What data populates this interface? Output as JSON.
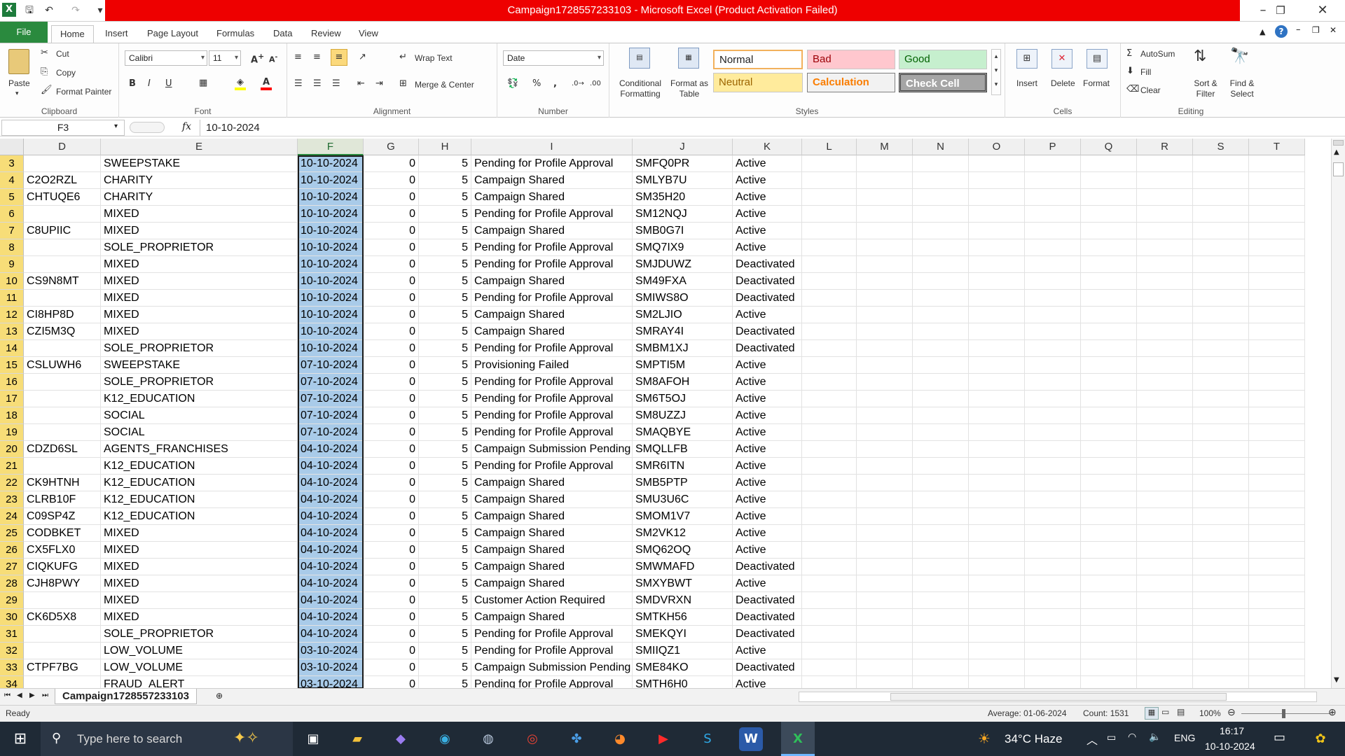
{
  "window": {
    "title": "Campaign1728557233103  -  Microsoft Excel (Product Activation Failed)"
  },
  "ribbon": {
    "tabs": [
      "File",
      "Home",
      "Insert",
      "Page Layout",
      "Formulas",
      "Data",
      "Review",
      "View"
    ],
    "clipboard": {
      "label": "Clipboard",
      "paste": "Paste",
      "cut": "Cut",
      "copy": "Copy",
      "format_painter": "Format Painter"
    },
    "font": {
      "label": "Font",
      "name": "Calibri",
      "size": "11"
    },
    "alignment": {
      "label": "Alignment",
      "wrap_text": "Wrap Text",
      "merge_center": "Merge & Center"
    },
    "number": {
      "label": "Number",
      "format": "Date"
    },
    "styles": {
      "label": "Styles",
      "conditional": "Conditional Formatting",
      "format_as_table": "Format as Table",
      "normal": "Normal",
      "bad": "Bad",
      "good": "Good",
      "neutral": "Neutral",
      "calculation": "Calculation",
      "check_cell": "Check Cell"
    },
    "cells": {
      "label": "Cells",
      "insert": "Insert",
      "delete": "Delete",
      "format": "Format"
    },
    "editing": {
      "label": "Editing",
      "autosum": "AutoSum",
      "fill": "Fill",
      "clear": "Clear",
      "sort_filter": "Sort & Filter",
      "find_select": "Find & Select"
    }
  },
  "formula_bar": {
    "name_box": "F3",
    "fx": "fx",
    "value": "10-10-2024"
  },
  "columns": [
    "D",
    "E",
    "F",
    "G",
    "H",
    "I",
    "J",
    "K",
    "L",
    "M",
    "N",
    "O",
    "P",
    "Q",
    "R",
    "S",
    "T"
  ],
  "rows": [
    {
      "n": "3",
      "d": "",
      "e": "SWEEPSTAKE",
      "f": "10-10-2024",
      "g": "0",
      "h": "5",
      "i": "Pending for Profile Approval",
      "j": "SMFQ0PR",
      "k": "Active"
    },
    {
      "n": "4",
      "d": "C2O2RZL",
      "e": "CHARITY",
      "f": "10-10-2024",
      "g": "0",
      "h": "5",
      "i": "Campaign Shared",
      "j": "SMLYB7U",
      "k": "Active"
    },
    {
      "n": "5",
      "d": "CHTUQE6",
      "e": "CHARITY",
      "f": "10-10-2024",
      "g": "0",
      "h": "5",
      "i": "Campaign Shared",
      "j": "SM35H20",
      "k": "Active"
    },
    {
      "n": "6",
      "d": "",
      "e": "MIXED",
      "f": "10-10-2024",
      "g": "0",
      "h": "5",
      "i": "Pending for Profile Approval",
      "j": "SM12NQJ",
      "k": "Active"
    },
    {
      "n": "7",
      "d": "C8UPIIC",
      "e": "MIXED",
      "f": "10-10-2024",
      "g": "0",
      "h": "5",
      "i": "Campaign Shared",
      "j": "SMB0G7I",
      "k": "Active"
    },
    {
      "n": "8",
      "d": "",
      "e": "SOLE_PROPRIETOR",
      "f": "10-10-2024",
      "g": "0",
      "h": "5",
      "i": "Pending for Profile Approval",
      "j": "SMQ7IX9",
      "k": "Active"
    },
    {
      "n": "9",
      "d": "",
      "e": "MIXED",
      "f": "10-10-2024",
      "g": "0",
      "h": "5",
      "i": "Pending for Profile Approval",
      "j": "SMJDUWZ",
      "k": "Deactivated"
    },
    {
      "n": "10",
      "d": "CS9N8MT",
      "e": "MIXED",
      "f": "10-10-2024",
      "g": "0",
      "h": "5",
      "i": "Campaign Shared",
      "j": "SM49FXA",
      "k": "Deactivated"
    },
    {
      "n": "11",
      "d": "",
      "e": "MIXED",
      "f": "10-10-2024",
      "g": "0",
      "h": "5",
      "i": "Pending for Profile Approval",
      "j": "SMIWS8O",
      "k": "Deactivated"
    },
    {
      "n": "12",
      "d": "CI8HP8D",
      "e": "MIXED",
      "f": "10-10-2024",
      "g": "0",
      "h": "5",
      "i": "Campaign Shared",
      "j": "SM2LJIO",
      "k": "Active"
    },
    {
      "n": "13",
      "d": "CZI5M3Q",
      "e": "MIXED",
      "f": "10-10-2024",
      "g": "0",
      "h": "5",
      "i": "Campaign Shared",
      "j": "SMRAY4I",
      "k": "Deactivated"
    },
    {
      "n": "14",
      "d": "",
      "e": "SOLE_PROPRIETOR",
      "f": "10-10-2024",
      "g": "0",
      "h": "5",
      "i": "Pending for Profile Approval",
      "j": "SMBM1XJ",
      "k": "Deactivated"
    },
    {
      "n": "15",
      "d": "CSLUWH6",
      "e": "SWEEPSTAKE",
      "f": "07-10-2024",
      "g": "0",
      "h": "5",
      "i": "Provisioning Failed",
      "j": "SMPTI5M",
      "k": "Active"
    },
    {
      "n": "16",
      "d": "",
      "e": "SOLE_PROPRIETOR",
      "f": "07-10-2024",
      "g": "0",
      "h": "5",
      "i": "Pending for Profile Approval",
      "j": "SM8AFOH",
      "k": "Active"
    },
    {
      "n": "17",
      "d": "",
      "e": "K12_EDUCATION",
      "f": "07-10-2024",
      "g": "0",
      "h": "5",
      "i": "Pending for Profile Approval",
      "j": "SM6T5OJ",
      "k": "Active"
    },
    {
      "n": "18",
      "d": "",
      "e": "SOCIAL",
      "f": "07-10-2024",
      "g": "0",
      "h": "5",
      "i": "Pending for Profile Approval",
      "j": "SM8UZZJ",
      "k": "Active"
    },
    {
      "n": "19",
      "d": "",
      "e": "SOCIAL",
      "f": "07-10-2024",
      "g": "0",
      "h": "5",
      "i": "Pending for Profile Approval",
      "j": "SMAQBYE",
      "k": "Active"
    },
    {
      "n": "20",
      "d": "CDZD6SL",
      "e": "AGENTS_FRANCHISES",
      "f": "04-10-2024",
      "g": "0",
      "h": "5",
      "i": "Campaign Submission Pending",
      "j": "SMQLLFB",
      "k": "Active"
    },
    {
      "n": "21",
      "d": "",
      "e": "K12_EDUCATION",
      "f": "04-10-2024",
      "g": "0",
      "h": "5",
      "i": "Pending for Profile Approval",
      "j": "SMR6ITN",
      "k": "Active"
    },
    {
      "n": "22",
      "d": "CK9HTNH",
      "e": "K12_EDUCATION",
      "f": "04-10-2024",
      "g": "0",
      "h": "5",
      "i": "Campaign Shared",
      "j": "SMB5PTP",
      "k": "Active"
    },
    {
      "n": "23",
      "d": "CLRB10F",
      "e": "K12_EDUCATION",
      "f": "04-10-2024",
      "g": "0",
      "h": "5",
      "i": "Campaign Shared",
      "j": "SMU3U6C",
      "k": "Active"
    },
    {
      "n": "24",
      "d": "C09SP4Z",
      "e": "K12_EDUCATION",
      "f": "04-10-2024",
      "g": "0",
      "h": "5",
      "i": "Campaign Shared",
      "j": "SMOM1V7",
      "k": "Active"
    },
    {
      "n": "25",
      "d": "CODBKET",
      "e": "MIXED",
      "f": "04-10-2024",
      "g": "0",
      "h": "5",
      "i": "Campaign Shared",
      "j": "SM2VK12",
      "k": "Active"
    },
    {
      "n": "26",
      "d": "CX5FLX0",
      "e": "MIXED",
      "f": "04-10-2024",
      "g": "0",
      "h": "5",
      "i": "Campaign Shared",
      "j": "SMQ62OQ",
      "k": "Active"
    },
    {
      "n": "27",
      "d": "CIQKUFG",
      "e": "MIXED",
      "f": "04-10-2024",
      "g": "0",
      "h": "5",
      "i": "Campaign Shared",
      "j": "SMWMAFD",
      "k": "Deactivated"
    },
    {
      "n": "28",
      "d": "CJH8PWY",
      "e": "MIXED",
      "f": "04-10-2024",
      "g": "0",
      "h": "5",
      "i": "Campaign Shared",
      "j": "SMXYBWT",
      "k": "Active"
    },
    {
      "n": "29",
      "d": "",
      "e": "MIXED",
      "f": "04-10-2024",
      "g": "0",
      "h": "5",
      "i": "Customer Action Required",
      "j": "SMDVRXN",
      "k": "Deactivated"
    },
    {
      "n": "30",
      "d": "CK6D5X8",
      "e": "MIXED",
      "f": "04-10-2024",
      "g": "0",
      "h": "5",
      "i": "Campaign Shared",
      "j": "SMTKH56",
      "k": "Deactivated"
    },
    {
      "n": "31",
      "d": "",
      "e": "SOLE_PROPRIETOR",
      "f": "04-10-2024",
      "g": "0",
      "h": "5",
      "i": "Pending for Profile Approval",
      "j": "SMEKQYI",
      "k": "Deactivated"
    },
    {
      "n": "32",
      "d": "",
      "e": "LOW_VOLUME",
      "f": "03-10-2024",
      "g": "0",
      "h": "5",
      "i": "Pending for Profile Approval",
      "j": "SMIIQZ1",
      "k": "Active"
    },
    {
      "n": "33",
      "d": "CTPF7BG",
      "e": "LOW_VOLUME",
      "f": "03-10-2024",
      "g": "0",
      "h": "5",
      "i": "Campaign Submission Pending",
      "j": "SME84KO",
      "k": "Deactivated"
    },
    {
      "n": "34",
      "d": "",
      "e": "FRAUD_ALERT",
      "f": "03-10-2024",
      "g": "0",
      "h": "5",
      "i": "Pending for Profile Approval",
      "j": "SMTH6H0",
      "k": "Active"
    }
  ],
  "sheet_tab": "Campaign1728557233103",
  "status": {
    "ready": "Ready",
    "average": "Average: 01-06-2024",
    "count": "Count: 1531",
    "zoom": "100%"
  },
  "taskbar": {
    "search_placeholder": "Type here to search",
    "weather": "34°C  Haze",
    "lang": "ENG",
    "time": "16:17",
    "date": "10-10-2024"
  },
  "colors": {
    "file_tab": "#2a8a3e",
    "title_bar": "#ee0000",
    "selection": "#a9cbe9",
    "row_header_selected": "#f7dd78"
  }
}
